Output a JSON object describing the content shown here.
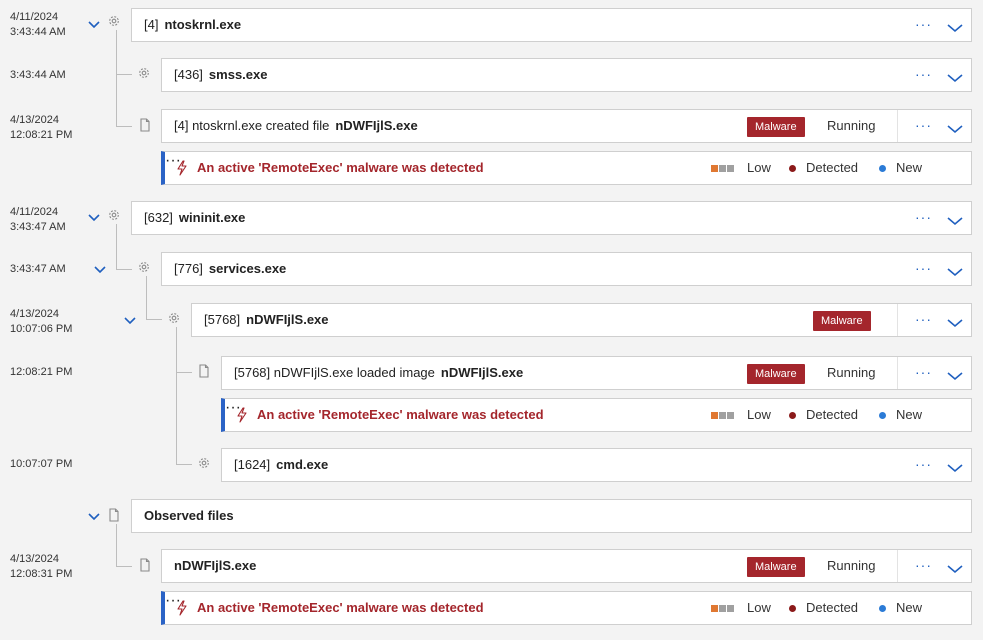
{
  "timestamps": {
    "t1_date": "4/11/2024",
    "t1_time": "3:43:44 AM",
    "t2_time": "3:43:44 AM",
    "t3_date": "4/13/2024",
    "t3_time": "12:08:21 PM",
    "t4_date": "4/11/2024",
    "t4_time": "3:43:47 AM",
    "t5_time": "3:43:47 AM",
    "t6_date": "4/13/2024",
    "t6_time": "10:07:06 PM",
    "t7_time": "12:08:21 PM",
    "t8_time": "10:07:07 PM",
    "t9_date": "4/13/2024",
    "t9_time": "12:08:31 PM"
  },
  "processes": {
    "ntoskrnl": {
      "pid": "[4]",
      "name": "ntoskrnl.exe"
    },
    "smss": {
      "pid": "[436]",
      "name": "smss.exe"
    },
    "file_event": {
      "prefix": "[4] ntoskrnl.exe created file",
      "name": "nDWFIjlS.exe"
    },
    "wininit": {
      "pid": "[632]",
      "name": "wininit.exe"
    },
    "services": {
      "pid": "[776]",
      "name": "services.exe"
    },
    "ndw": {
      "pid": "[5768]",
      "name": "nDWFIjlS.exe"
    },
    "image_event": {
      "prefix": "[5768] nDWFIjlS.exe loaded image",
      "name": "nDWFIjlS.exe"
    },
    "cmd": {
      "pid": "[1624]",
      "name": "cmd.exe"
    },
    "observed_file": {
      "name": "nDWFIjlS.exe"
    }
  },
  "labels": {
    "malware": "Malware",
    "running": "Running",
    "more": "···",
    "observed_files": "Observed files"
  },
  "alert": {
    "text": "An active 'RemoteExec' malware was detected",
    "severity": "Low",
    "status": "Detected",
    "state": "New"
  },
  "colors": {
    "accent": "#1f5fbf",
    "malware_badge": "#a4262c",
    "alert_text": "#a4262c",
    "severity_low": "#e07832",
    "detected_dot": "#8b1a1a",
    "new_dot": "#2b7bd6"
  },
  "icons": {
    "chevron": "chevron-down-icon",
    "gear": "gear-icon",
    "file": "file-icon",
    "bolt": "lightning-icon"
  }
}
